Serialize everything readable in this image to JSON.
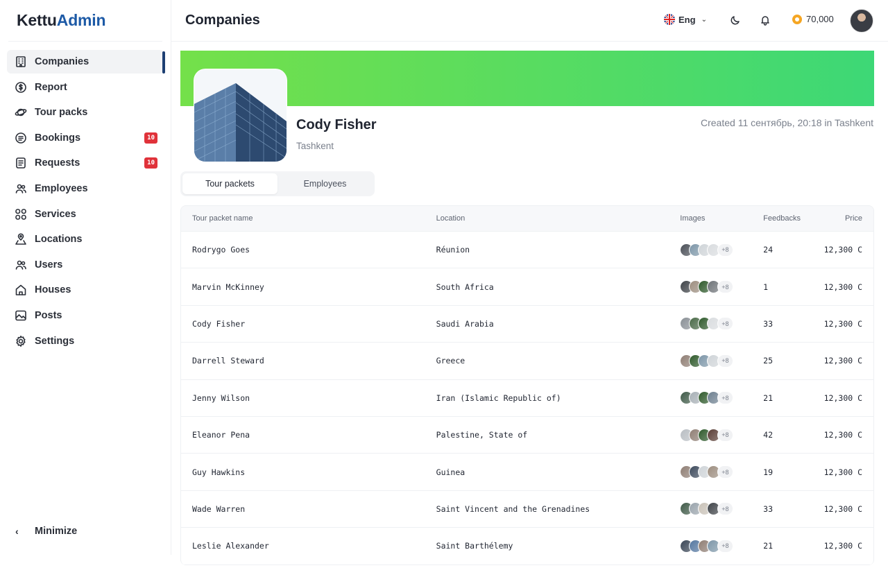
{
  "app": {
    "logo_part1": "Kettu",
    "logo_part2": "Admin"
  },
  "sidebar": {
    "items": [
      {
        "label": "Companies",
        "icon": "building-icon",
        "active": true
      },
      {
        "label": "Report",
        "icon": "dollar-circle-icon"
      },
      {
        "label": "Tour packs",
        "icon": "planet-icon"
      },
      {
        "label": "Bookings",
        "icon": "ticket-icon",
        "badge": "10"
      },
      {
        "label": "Requests",
        "icon": "document-icon",
        "badge": "10"
      },
      {
        "label": "Employees",
        "icon": "users-icon"
      },
      {
        "label": "Services",
        "icon": "grid-icon"
      },
      {
        "label": "Locations",
        "icon": "location-icon"
      },
      {
        "label": "Users",
        "icon": "users-icon"
      },
      {
        "label": "Houses",
        "icon": "house-icon"
      },
      {
        "label": "Posts",
        "icon": "image-icon"
      },
      {
        "label": "Settings",
        "icon": "gear-icon"
      }
    ],
    "minimize_label": "Minimize"
  },
  "header": {
    "title": "Companies",
    "language": "Eng",
    "coins": "70,000"
  },
  "company": {
    "name": "Cody Fisher",
    "city": "Tashkent",
    "created": "Created 11 сентябрь, 20:18 in Tashkent"
  },
  "tabs": [
    {
      "label": "Tour packets",
      "active": true
    },
    {
      "label": "Employees",
      "active": false
    }
  ],
  "table": {
    "columns": [
      "Tour packet name",
      "Location",
      "Images",
      "Feedbacks",
      "Price"
    ],
    "more_label": "+8",
    "rows": [
      {
        "name": "Rodrygo Goes",
        "location": "Réunion",
        "feedbacks": "24",
        "price": "12,300 C",
        "thumbs": [
          "#4a4f57",
          "#7d96a8",
          "#cfd4d8",
          "#d9dcdf"
        ]
      },
      {
        "name": "Marvin McKinney",
        "location": "South Africa",
        "feedbacks": "1",
        "price": "12,300 C",
        "thumbs": [
          "#3f4348",
          "#9c8d7f",
          "#2f5a2c",
          "#6e7378"
        ]
      },
      {
        "name": "Cody Fisher",
        "location": "Saudi Arabia",
        "feedbacks": "33",
        "price": "12,300 C",
        "thumbs": [
          "#8a9096",
          "#4a6a48",
          "#2f5a2c",
          "#d9dcdf"
        ]
      },
      {
        "name": "Darrell Steward",
        "location": "Greece",
        "feedbacks": "25",
        "price": "12,300 C",
        "thumbs": [
          "#8f7e74",
          "#2f5a2c",
          "#7d96a8",
          "#cfd4d8"
        ]
      },
      {
        "name": "Jenny Wilson",
        "location": "Iran (Islamic Republic of)",
        "feedbacks": "21",
        "price": "12,300 C",
        "thumbs": [
          "#3f5a48",
          "#a8b0b6",
          "#2f5a2c",
          "#6e8090"
        ]
      },
      {
        "name": "Eleanor Pena",
        "location": "Palestine, State of",
        "feedbacks": "42",
        "price": "12,300 C",
        "thumbs": [
          "#b9bec3",
          "#8f7e74",
          "#2f5a2c",
          "#5a3e36"
        ]
      },
      {
        "name": "Guy Hawkins",
        "location": "Guinea",
        "feedbacks": "19",
        "price": "12,300 C",
        "thumbs": [
          "#8f7e74",
          "#3d4a5c",
          "#cfd4d8",
          "#9c8d7f"
        ]
      },
      {
        "name": "Wade Warren",
        "location": "Saint Vincent and the Grenadines",
        "feedbacks": "33",
        "price": "12,300 C",
        "thumbs": [
          "#3f5a48",
          "#9aa4ac",
          "#c9c2b8",
          "#3f4348"
        ]
      },
      {
        "name": "Leslie Alexander",
        "location": "Saint Barthélemy",
        "feedbacks": "21",
        "price": "12,300 C",
        "thumbs": [
          "#3a4656",
          "#5577a0",
          "#8f7e74",
          "#7d96a8"
        ]
      }
    ]
  },
  "colors": {
    "brand_dark": "#1f2430",
    "brand_blue": "#1d5aa6",
    "active_indicator": "#1d3f73",
    "banner_start": "#74e04a",
    "banner_end": "#3dd876",
    "badge_red": "#e0323a",
    "coin_orange": "#f5a623"
  }
}
